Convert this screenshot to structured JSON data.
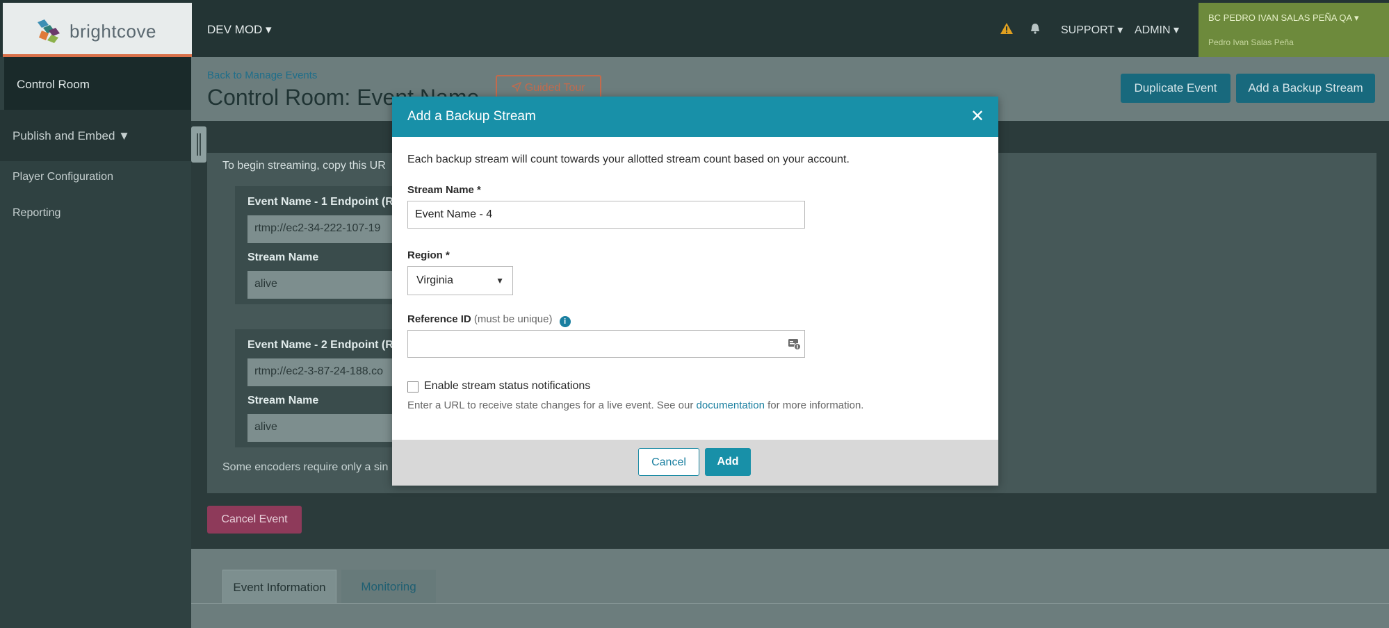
{
  "brand": {
    "name": "brightcove"
  },
  "topbar": {
    "env_menu": "DEV MOD ▾",
    "support": "SUPPORT ▾",
    "admin": "ADMIN ▾",
    "account_name": "BC PEDRO IVAN SALAS PEÑA QA ▾",
    "account_user": "Pedro Ivan Salas Peña",
    "icons": [
      "warning-icon",
      "bell-icon"
    ]
  },
  "sidebar": {
    "items": [
      {
        "label": "Control Room"
      },
      {
        "label": "Publish and Embed ▼"
      },
      {
        "label": "Player Configuration"
      },
      {
        "label": "Reporting"
      }
    ]
  },
  "header": {
    "back_link": "Back to Manage Events",
    "title": "Control Room: Event Name",
    "guided_tour": "Guided Tour",
    "duplicate_event": "Duplicate Event",
    "add_backup_stream": "Add a Backup Stream"
  },
  "card": {
    "intro": "To begin streaming, copy this UR",
    "endpoints": [
      {
        "label": "Event Name - 1 Endpoint (R",
        "url": "rtmp://ec2-34-222-107-19",
        "stream_label": "Stream Name",
        "stream_value": "alive"
      },
      {
        "label": "Event Name - 2 Endpoint (R",
        "url": "rtmp://ec2-3-87-24-188.co",
        "stream_label": "Stream Name",
        "stream_value": "alive"
      }
    ],
    "footer": "Some encoders require only a sin"
  },
  "cancel_event": "Cancel Event",
  "tabs": [
    {
      "label": "Event Information",
      "active": true
    },
    {
      "label": "Monitoring",
      "active": false
    }
  ],
  "modal": {
    "title": "Add a Backup Stream",
    "close": "✕",
    "intro": "Each backup stream will count towards your allotted stream count based on your account.",
    "stream_name_label": "Stream Name *",
    "stream_name_value": "Event Name - 4",
    "region_label": "Region *",
    "region_value": "Virginia",
    "reference_label": "Reference ID",
    "reference_hint": "(must be unique)",
    "reference_value": "",
    "notify_label": "Enable stream status notifications",
    "notify_hint_before": "Enter a URL to receive state changes for a live event. See our ",
    "notify_hint_link": "documentation",
    "notify_hint_after": " for more information.",
    "cancel": "Cancel",
    "add": "Add"
  },
  "colors": {
    "modal_header": "#1890a8",
    "primary_button": "#18697d",
    "guided_tour": "#c46a4c",
    "danger": "#8e3a5a",
    "account": "#6d8a3c"
  }
}
